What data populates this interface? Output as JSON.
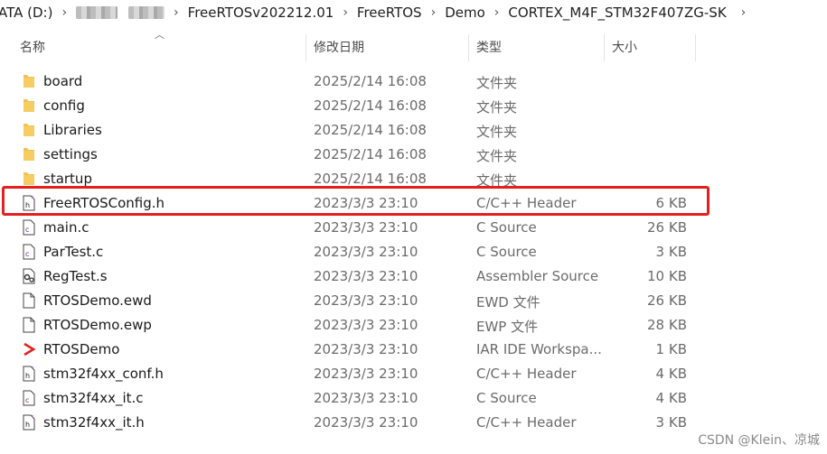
{
  "breadcrumb": {
    "items": [
      "ATA (D:)",
      "FreeRTOSv202212.01",
      "FreeRTOS",
      "Demo",
      "CORTEX_M4F_STM32F407ZG-SK"
    ]
  },
  "columns": {
    "name": "名称",
    "date": "修改日期",
    "type": "类型",
    "size": "大小"
  },
  "files": [
    {
      "name": "board",
      "date": "2025/2/14 16:08",
      "type": "文件夹",
      "size": "",
      "icon": "folder-icon"
    },
    {
      "name": "config",
      "date": "2025/2/14 16:08",
      "type": "文件夹",
      "size": "",
      "icon": "folder-icon"
    },
    {
      "name": "Libraries",
      "date": "2025/2/14 16:08",
      "type": "文件夹",
      "size": "",
      "icon": "folder-icon"
    },
    {
      "name": "settings",
      "date": "2025/2/14 16:08",
      "type": "文件夹",
      "size": "",
      "icon": "folder-icon"
    },
    {
      "name": "startup",
      "date": "2025/2/14 16:08",
      "type": "文件夹",
      "size": "",
      "icon": "folder-icon"
    },
    {
      "name": "FreeRTOSConfig.h",
      "date": "2023/3/3 23:10",
      "type": "C/C++ Header",
      "size": "6 KB",
      "icon": "header-file-icon"
    },
    {
      "name": "main.c",
      "date": "2023/3/3 23:10",
      "type": "C Source",
      "size": "26 KB",
      "icon": "c-file-icon"
    },
    {
      "name": "ParTest.c",
      "date": "2023/3/3 23:10",
      "type": "C Source",
      "size": "3 KB",
      "icon": "c-file-icon"
    },
    {
      "name": "RegTest.s",
      "date": "2023/3/3 23:10",
      "type": "Assembler Source",
      "size": "10 KB",
      "icon": "asm-file-icon"
    },
    {
      "name": "RTOSDemo.ewd",
      "date": "2023/3/3 23:10",
      "type": "EWD 文件",
      "size": "26 KB",
      "icon": "blank-file-icon"
    },
    {
      "name": "RTOSDemo.ewp",
      "date": "2023/3/3 23:10",
      "type": "EWP 文件",
      "size": "28 KB",
      "icon": "blank-file-icon"
    },
    {
      "name": "RTOSDemo",
      "date": "2023/3/3 23:10",
      "type": "IAR IDE Workspa...",
      "size": "1 KB",
      "icon": "iar-workspace-icon"
    },
    {
      "name": "stm32f4xx_conf.h",
      "date": "2023/3/3 23:10",
      "type": "C/C++ Header",
      "size": "4 KB",
      "icon": "header-file-icon"
    },
    {
      "name": "stm32f4xx_it.c",
      "date": "2023/3/3 23:10",
      "type": "C Source",
      "size": "4 KB",
      "icon": "c-file-icon"
    },
    {
      "name": "stm32f4xx_it.h",
      "date": "2023/3/3 23:10",
      "type": "C/C++ Header",
      "size": "3 KB",
      "icon": "header-file-icon"
    }
  ],
  "watermark": "CSDN @Klein、凉城",
  "colors": {
    "highlight": "#e51f1f",
    "folder": "#f2c14e"
  }
}
